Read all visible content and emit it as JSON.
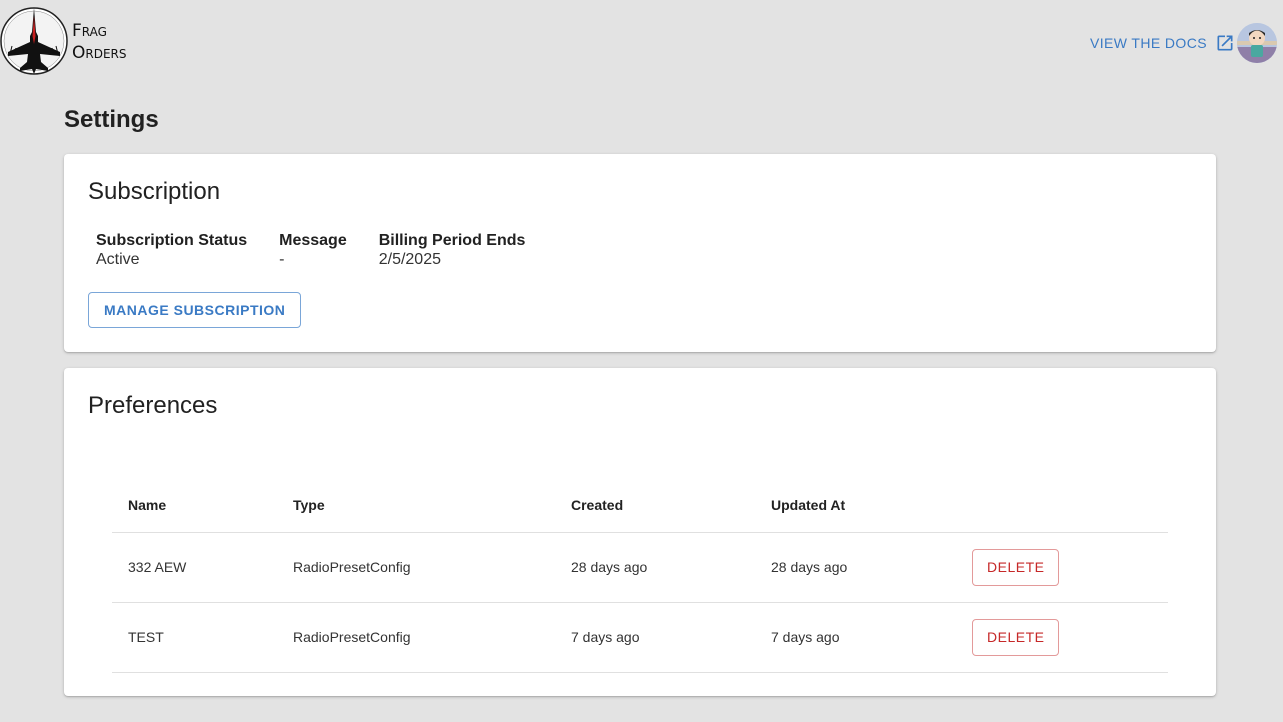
{
  "brand": {
    "line1": "Frag",
    "line2": "Orders"
  },
  "header": {
    "docs_label": "VIEW THE DOCS"
  },
  "page": {
    "title": "Settings"
  },
  "subscription": {
    "title": "Subscription",
    "fields": [
      {
        "label": "Subscription Status",
        "value": "Active"
      },
      {
        "label": "Message",
        "value": "-"
      },
      {
        "label": "Billing Period Ends",
        "value": "2/5/2025"
      }
    ],
    "manage_label": "MANAGE SUBSCRIPTION"
  },
  "preferences": {
    "title": "Preferences",
    "columns": [
      "Name",
      "Type",
      "Created",
      "Updated At",
      ""
    ],
    "rows": [
      {
        "name": "332 AEW",
        "type": "RadioPresetConfig",
        "created": "28 days ago",
        "updated": "28 days ago",
        "action": "DELETE"
      },
      {
        "name": "TEST",
        "type": "RadioPresetConfig",
        "created": "7 days ago",
        "updated": "7 days ago",
        "action": "DELETE"
      }
    ]
  },
  "colors": {
    "accent": "#3a7ac4",
    "danger": "#c62828",
    "background": "#e3e3e3"
  },
  "icons": {
    "docs": "open-in-new-icon",
    "logo": "fighter-jet-logo"
  }
}
